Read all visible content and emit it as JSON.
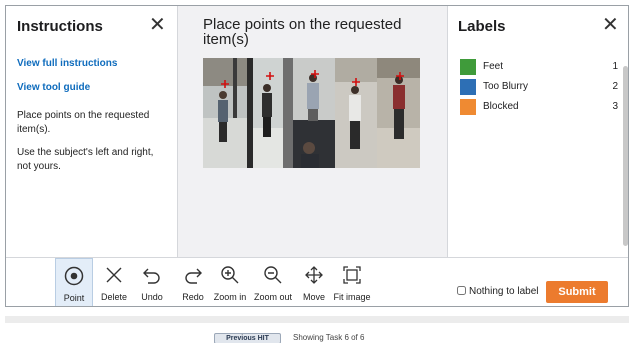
{
  "instructions": {
    "title": "Instructions",
    "close_symbol": "✕",
    "link_full": "View full instructions",
    "link_guide": "View tool guide",
    "text1": "Place points on the requested item(s).",
    "text2": "Use the subject's left and right, not yours."
  },
  "task": {
    "prompt": "Place points on the requested item(s)"
  },
  "labels": {
    "title": "Labels",
    "close_symbol": "✕",
    "items": [
      {
        "name": "Feet",
        "key": "1",
        "color": "#3f9b3a"
      },
      {
        "name": "Too Blurry",
        "key": "2",
        "color": "#2d6fb5"
      },
      {
        "name": "Blocked",
        "key": "3",
        "color": "#ef8a32"
      }
    ]
  },
  "toolbar": {
    "tools": [
      {
        "label": "Point",
        "icon": "point-icon"
      },
      {
        "label": "Delete",
        "icon": "delete-icon"
      },
      {
        "label": "Undo",
        "icon": "undo-icon"
      },
      {
        "label": "Redo",
        "icon": "redo-icon"
      },
      {
        "label": "Zoom in",
        "icon": "zoom-in-icon"
      },
      {
        "label": "Zoom out",
        "icon": "zoom-out-icon"
      },
      {
        "label": "Move",
        "icon": "move-icon"
      },
      {
        "label": "Fit image",
        "icon": "fit-image-icon"
      }
    ],
    "nothing_label": "Nothing to label",
    "submit_label": "Submit",
    "submit_color": "#ec7b2e"
  },
  "footer": {
    "previous_label": "Previous HIT",
    "showing_text": "Showing Task 6 of 6"
  }
}
